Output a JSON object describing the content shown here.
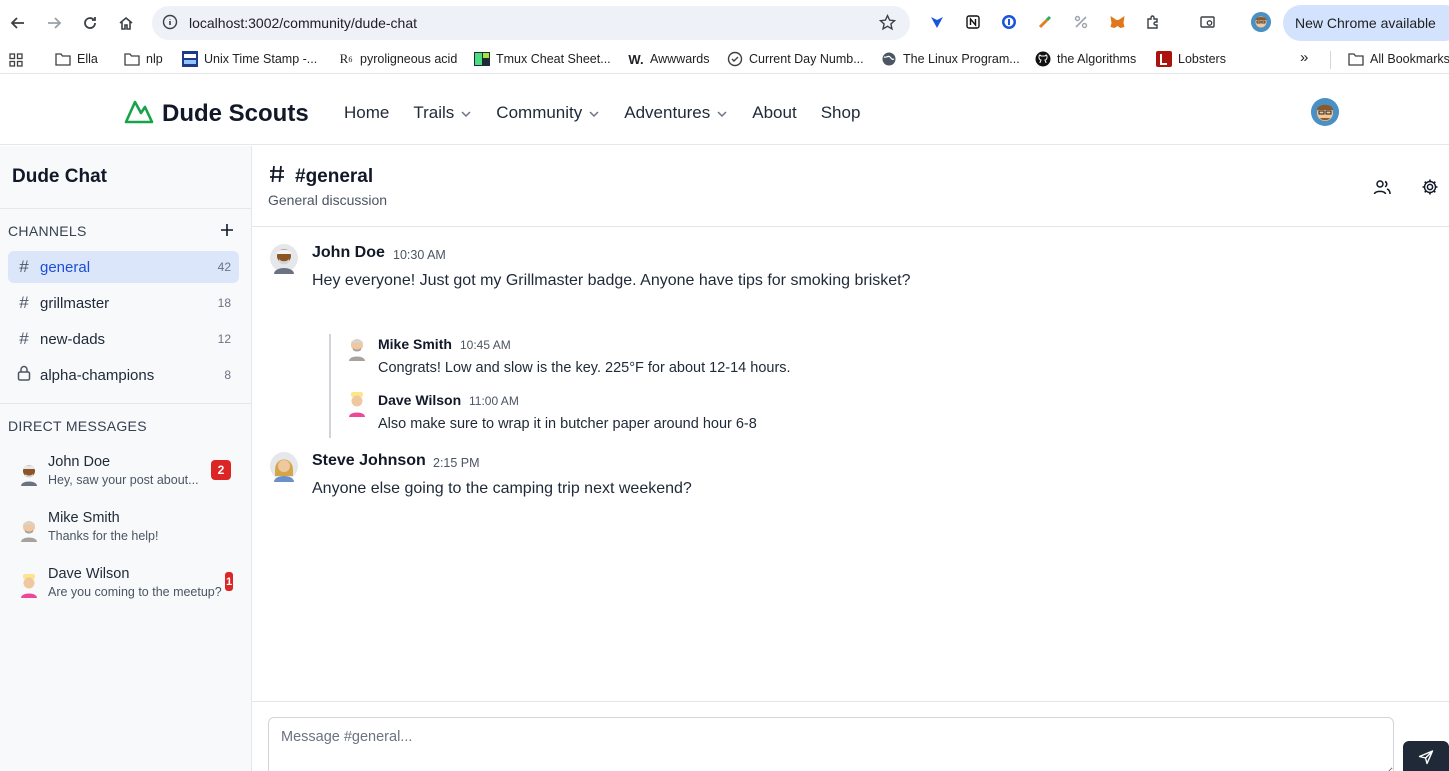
{
  "browser": {
    "url": "localhost:3002/community/dude-chat",
    "update_button": "New Chrome available",
    "bookmarks": [
      {
        "label": "Ella"
      },
      {
        "label": "nlp"
      },
      {
        "label": "Unix Time Stamp -..."
      },
      {
        "label": "pyroligneous acid"
      },
      {
        "label": "Tmux Cheat Sheet..."
      },
      {
        "label": "Awwwards"
      },
      {
        "label": "Current Day Numb..."
      },
      {
        "label": "The Linux Program..."
      },
      {
        "label": "the Algorithms"
      },
      {
        "label": "Lobsters"
      }
    ],
    "all_bookmarks": "All Bookmarks",
    "overflow": "»"
  },
  "header": {
    "brand": "Dude Scouts",
    "nav": [
      {
        "label": "Home"
      },
      {
        "label": "Trails"
      },
      {
        "label": "Community"
      },
      {
        "label": "Adventures"
      },
      {
        "label": "About"
      },
      {
        "label": "Shop"
      }
    ]
  },
  "sidebar": {
    "title": "Dude Chat",
    "channels_label": "CHANNELS",
    "channels": [
      {
        "name": "general",
        "count": "42",
        "icon": "hash-icon"
      },
      {
        "name": "grillmaster",
        "count": "18",
        "icon": "hash-icon"
      },
      {
        "name": "new-dads",
        "count": "12",
        "icon": "hash-icon"
      },
      {
        "name": "alpha-champions",
        "count": "8",
        "icon": "lock-icon"
      }
    ],
    "dm_label": "DIRECT MESSAGES",
    "dms": [
      {
        "name": "John Doe",
        "preview": "Hey, saw your post about...",
        "unread": "2"
      },
      {
        "name": "Mike Smith",
        "preview": "Thanks for the help!",
        "unread": ""
      },
      {
        "name": "Dave Wilson",
        "preview": "Are you coming to the meetup?",
        "unread": "1"
      }
    ]
  },
  "channel": {
    "hash": "#",
    "name": "#general",
    "description": "General discussion"
  },
  "messages": [
    {
      "author": "John Doe",
      "time": "10:30 AM",
      "text": "Hey everyone! Just got my Grillmaster badge. Anyone have tips for smoking brisket?"
    },
    {
      "author": "Steve Johnson",
      "time": "2:15 PM",
      "text": "Anyone else going to the camping trip next weekend?"
    }
  ],
  "replies": [
    {
      "author": "Mike Smith",
      "time": "10:45 AM",
      "text": "Congrats! Low and slow is the key. 225°F for about 12-14 hours."
    },
    {
      "author": "Dave Wilson",
      "time": "11:00 AM",
      "text": "Also make sure to wrap it in butcher paper around hour 6-8"
    }
  ],
  "composer": {
    "placeholder": "Message #general..."
  },
  "colors": {
    "accent": "#1d4ed8",
    "active_channel_bg": "#dbe6fb",
    "badge": "#dc2626",
    "logo_green": "#16a34a"
  }
}
